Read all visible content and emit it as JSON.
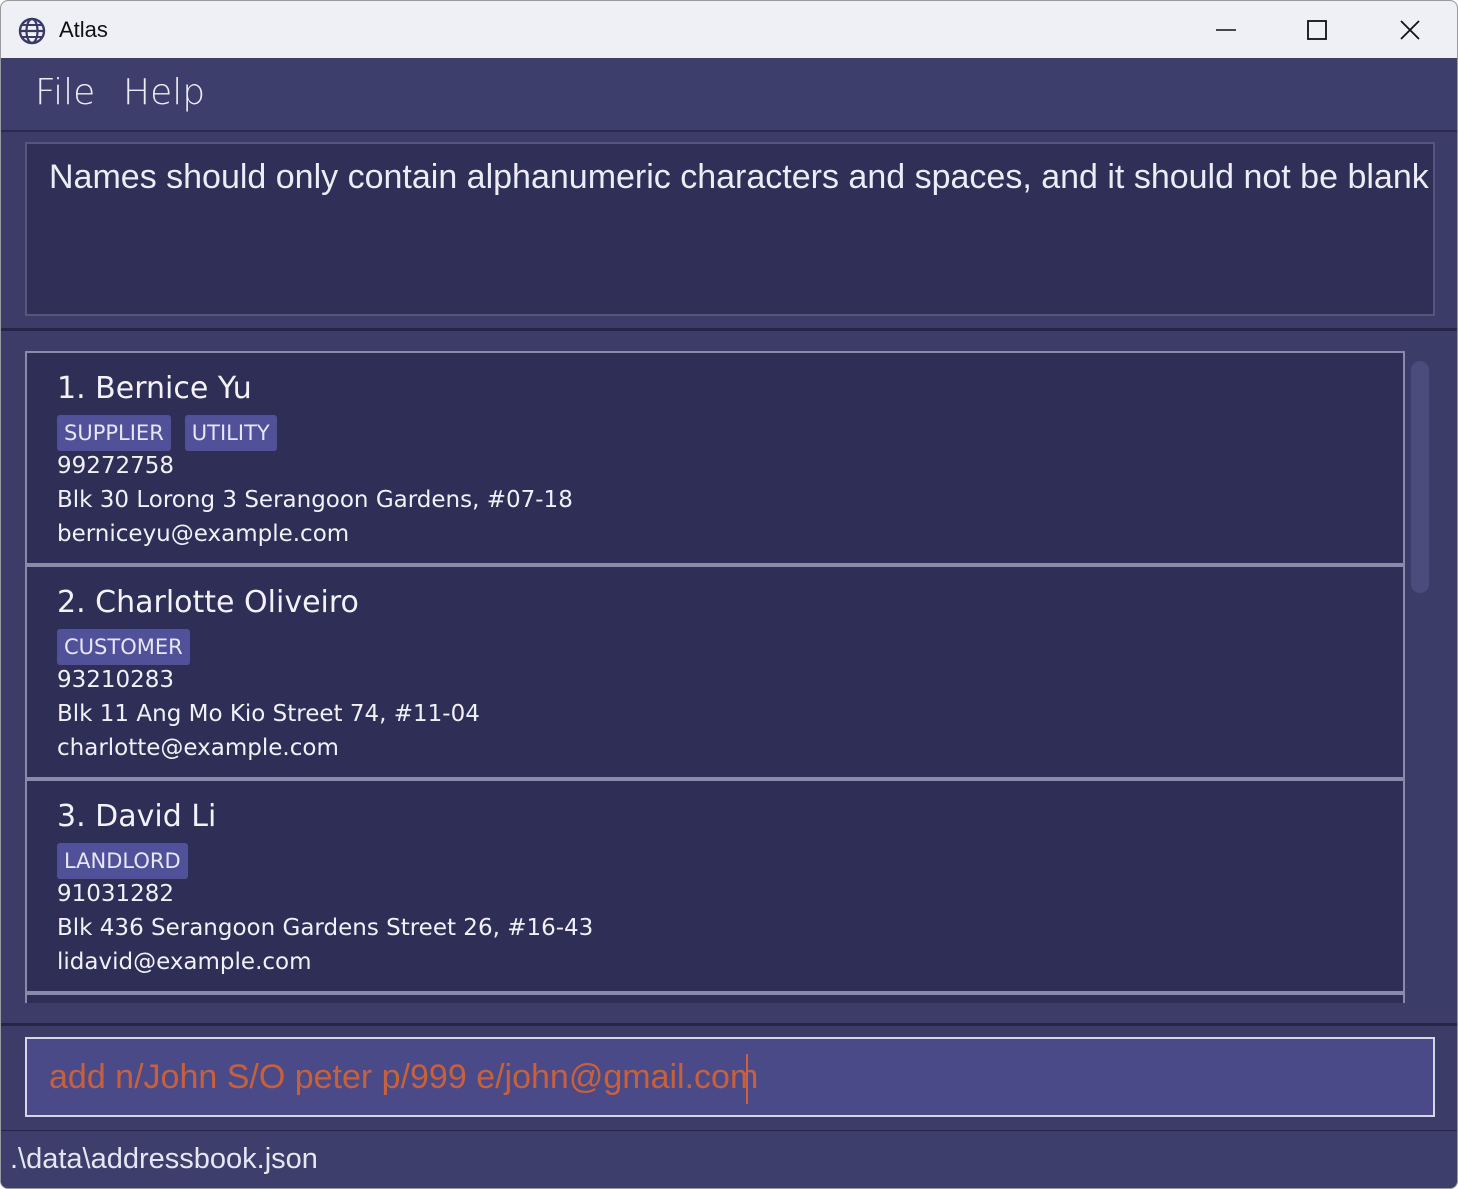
{
  "window": {
    "title": "Atlas",
    "icons": {
      "app": "globe-icon",
      "minimize": "minimize-icon",
      "maximize": "maximize-icon",
      "close": "close-icon"
    }
  },
  "menu": {
    "file": "File",
    "help": "Help"
  },
  "result": {
    "message": "Names should only contain alphanumeric characters and spaces, and it should not be blank"
  },
  "persons": [
    {
      "name": "1. Bernice Yu",
      "tags": [
        "SUPPLIER",
        "UTILITY"
      ],
      "phone": "99272758",
      "address": "Blk 30 Lorong 3 Serangoon Gardens, #07-18",
      "email": "berniceyu@example.com"
    },
    {
      "name": "2. Charlotte Oliveiro",
      "tags": [
        "CUSTOMER"
      ],
      "phone": "93210283",
      "address": "Blk 11 Ang Mo Kio Street 74, #11-04",
      "email": "charlotte@example.com"
    },
    {
      "name": "3. David Li",
      "tags": [
        "LANDLORD"
      ],
      "phone": "91031282",
      "address": "Blk 436 Serangoon Gardens Street 26, #16-43",
      "email": "lidavid@example.com"
    }
  ],
  "command": {
    "value": "add n/John S/O peter p/999 e/john@gmail.com"
  },
  "status": {
    "path": ".\\data\\addressbook.json"
  },
  "colors": {
    "background": "#3c3c69",
    "card": "#2e2e57",
    "tag": "#51519a",
    "command_text": "#c9603c",
    "command_box": "#4a4a88"
  }
}
